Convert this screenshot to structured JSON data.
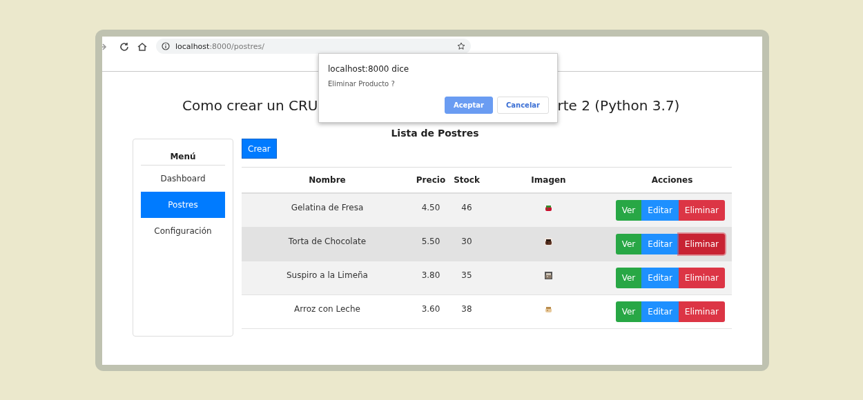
{
  "browser": {
    "url_host": "localhost",
    "url_rest": ":8000/postres/"
  },
  "page_title": {
    "left": "Como crear un CRU",
    "right": "rte 2 (Python 3.7)"
  },
  "dialog": {
    "title": "localhost:8000 dice",
    "message": "Eliminar Producto ?",
    "buttons": [
      {
        "label": "Aceptar",
        "kind": "primary"
      },
      {
        "label": "Cancelar",
        "kind": "secondary"
      }
    ]
  },
  "list_title": "Lista de Postres",
  "sidebar": {
    "heading": "Menú",
    "items": [
      {
        "label": "Dashboard",
        "selected": false
      },
      {
        "label": "Postres",
        "selected": true
      },
      {
        "label": "Configuración",
        "selected": false
      }
    ]
  },
  "create_button": "Crear",
  "table": {
    "columns": [
      "Nombre",
      "Precio",
      "Stock",
      "Imagen",
      "Acciones"
    ],
    "rows": [
      {
        "name": "Gelatina de Fresa",
        "price": "4.50",
        "stock": "46",
        "image": {
          "kind": "picture"
        },
        "highlighted": false,
        "actions": [
          {
            "label": "Ver",
            "kind": "view",
            "focused": false
          },
          {
            "label": "Editar",
            "kind": "edit",
            "focused": false
          },
          {
            "label": "Eliminar",
            "kind": "delete",
            "focused": false
          }
        ]
      },
      {
        "name": "Torta de Chocolate",
        "price": "5.50",
        "stock": "30",
        "image": {
          "kind": "picture"
        },
        "highlighted": true,
        "actions": [
          {
            "label": "Ver",
            "kind": "view",
            "focused": false
          },
          {
            "label": "Editar",
            "kind": "edit",
            "focused": false
          },
          {
            "label": "Eliminar",
            "kind": "delete",
            "focused": true
          }
        ]
      },
      {
        "name": "Suspiro a la Limeña",
        "price": "3.80",
        "stock": "35",
        "image": {
          "kind": "picture"
        },
        "highlighted": false,
        "actions": [
          {
            "label": "Ver",
            "kind": "view",
            "focused": false
          },
          {
            "label": "Editar",
            "kind": "edit",
            "focused": false
          },
          {
            "label": "Eliminar",
            "kind": "delete",
            "focused": false
          }
        ]
      },
      {
        "name": "Arroz con Leche",
        "price": "3.60",
        "stock": "38",
        "image": {
          "kind": "picture"
        },
        "highlighted": false,
        "actions": [
          {
            "label": "Ver",
            "kind": "view",
            "focused": false
          },
          {
            "label": "Editar",
            "kind": "edit",
            "focused": false
          },
          {
            "label": "Eliminar",
            "kind": "delete",
            "focused": false
          }
        ]
      }
    ]
  }
}
